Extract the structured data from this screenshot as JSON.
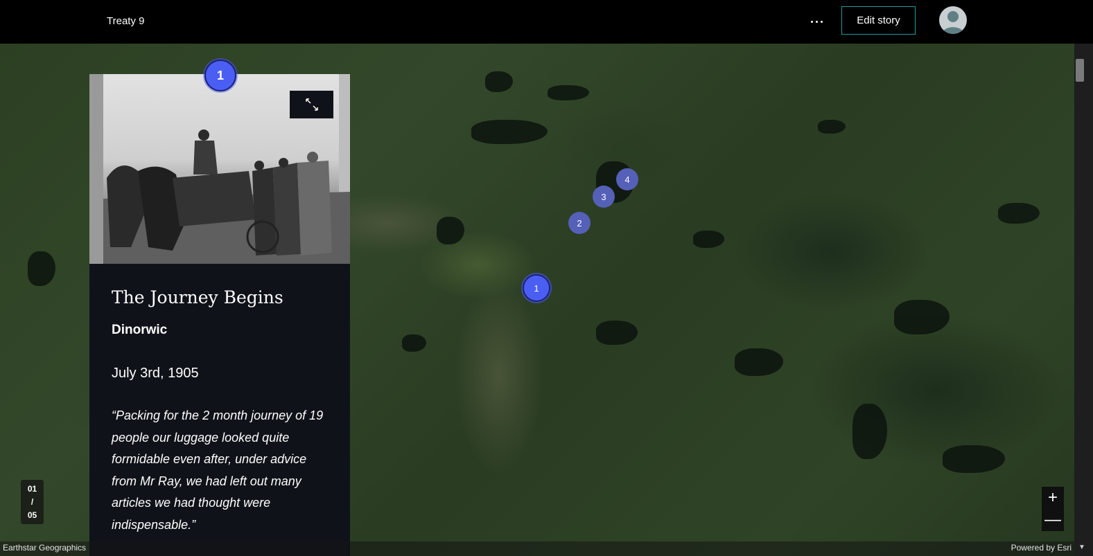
{
  "header": {
    "title": "Treaty 9",
    "more_icon": "ellipsis-icon",
    "edit_label": "Edit story",
    "avatar_icon": "user-avatar-icon"
  },
  "card": {
    "marker_number": "1",
    "title": "The Journey Begins",
    "subtitle": "Dinorwic",
    "date": "July 3rd, 1905",
    "quote": "“Packing for the 2 month journey of 19 people our luggage looked quite formidable even after, under advice from Mr Ray, we had left out many articles we had thought were indispensable.”",
    "fullscreen_icon": "expand-icon"
  },
  "map": {
    "markers": [
      {
        "label": "1",
        "active": true
      },
      {
        "label": "2",
        "active": false
      },
      {
        "label": "3",
        "active": false
      },
      {
        "label": "4",
        "active": false
      }
    ],
    "accent_color": "#4b5ef4",
    "marker_color": "#5560b8"
  },
  "page_counter": {
    "current": "01",
    "separator": "/",
    "total": "05"
  },
  "zoom": {
    "in_label": "+",
    "out_label": "—"
  },
  "attribution": {
    "left": "Earthstar Geographics",
    "right": "Powered by Esri"
  }
}
